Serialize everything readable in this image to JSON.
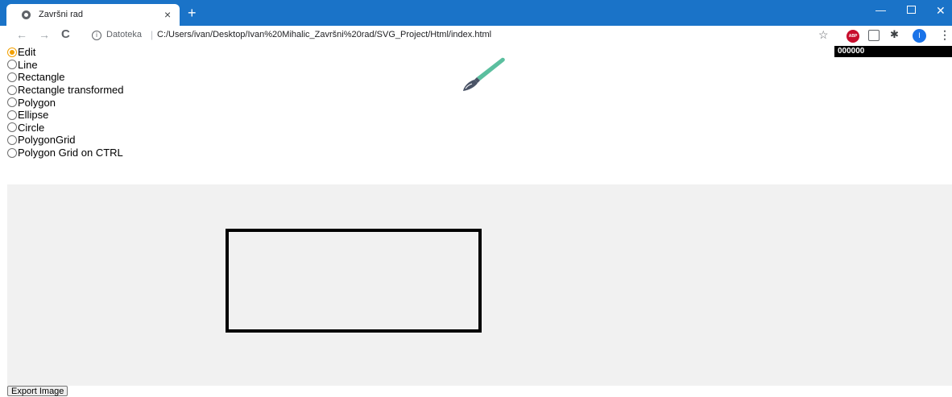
{
  "browser": {
    "tab_title": "Završni rad",
    "tab_close": "×",
    "new_tab": "+",
    "site_label": "Datoteka",
    "url_separator": "|",
    "url": "C:/Users/ivan/Desktop/Ivan%20Mihalic_Završni%20rad/SVG_Project/Html/index.html",
    "abp_label": "ABP",
    "profile_initial": "I",
    "window_controls": {
      "minimize": "—",
      "close": "✕"
    },
    "icons": {
      "back": "←",
      "forward": "→",
      "reload": "C",
      "info": "i",
      "star": "☆",
      "puzzle": "✱",
      "menu": "⋮"
    }
  },
  "toolbar": {
    "modes": [
      {
        "label": "Edit",
        "checked": true
      },
      {
        "label": "Line",
        "checked": false
      },
      {
        "label": "Rectangle",
        "checked": false
      },
      {
        "label": "Rectangle transformed",
        "checked": false
      },
      {
        "label": "Polygon",
        "checked": false
      },
      {
        "label": "Ellipse",
        "checked": false
      },
      {
        "label": "Circle",
        "checked": false
      },
      {
        "label": "PolygonGrid",
        "checked": false
      },
      {
        "label": "Polygon Grid on CTRL",
        "checked": false
      }
    ],
    "color_value": "000000"
  },
  "canvas": {
    "background": "#f1f1f1",
    "shapes": [
      {
        "type": "rectangle",
        "stroke": "#000000",
        "fill": "none"
      }
    ]
  },
  "export_button": "Export Image",
  "colors": {
    "titlebar": "#1a73c8",
    "radio_checked": "#f2a000",
    "brush_handle": "#5bbf9f",
    "brush_ferrule": "#4a5366"
  }
}
